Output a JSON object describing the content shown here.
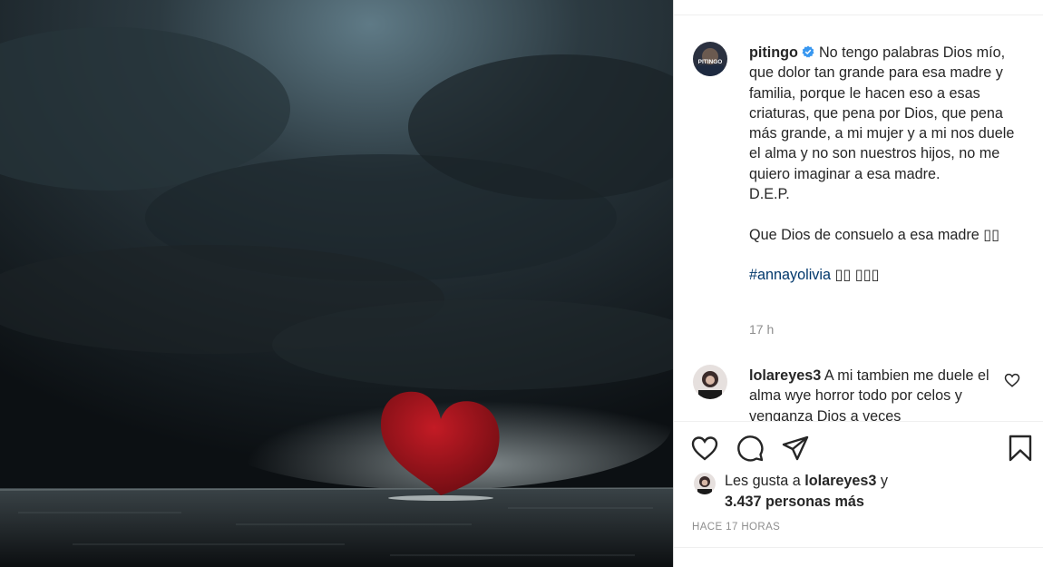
{
  "post": {
    "image_alt": "red-heart-on-stormy-sea",
    "author": "pitingo",
    "avatar_text": "PITINGO",
    "caption": "No tengo palabras Dios mío, que dolor tan grande para esa madre y familia, porque le hacen eso a esas criaturas, que pena por Dios, que pena más grande, a mi mujer y a mi nos duele el alma y no son nuestros hijos, no me quiero imaginar a esa madre.\nD.E.P.\n\nQue Dios de consuelo a esa madre ▯▯",
    "hashtag": "#annayolivia",
    "hashtag_suffix": " ▯▯ ▯▯▯",
    "time": "17 h"
  },
  "comment": {
    "user": "lolareyes3",
    "text": "A mi tambien me duele el alma wye horror todo por celos y venganza Dios a veces"
  },
  "likes": {
    "prefix": "Les gusta a ",
    "user": "lolareyes3",
    "middle": " y",
    "count_text": "3.437 personas más"
  },
  "timestamp": "HACE 17 HORAS",
  "colors": {
    "verified": "#3897f0",
    "heart": "#a8121c",
    "hashtag": "#00376b"
  }
}
